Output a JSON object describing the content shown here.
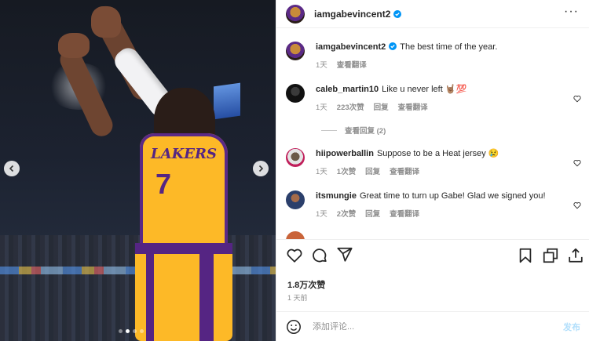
{
  "post": {
    "author": "iamgabevincent2",
    "caption": "The best time of the year.",
    "caption_time": "1天",
    "translate_label": "查看翻译",
    "more_icon": "more-horizontal-icon"
  },
  "photo": {
    "jersey_text": "LAKERS",
    "jersey_number": "7",
    "slide_count": 4,
    "active_slide": 2
  },
  "comments": [
    {
      "user": "caleb_martin10",
      "text": "Like u never left",
      "emoji": "🤘🏽💯",
      "time": "1天",
      "likes": "223次赞",
      "reply": "回复",
      "translate": "查看翻译"
    },
    {
      "user": "hiipowerballin",
      "text": "Suppose to be a Heat jersey",
      "emoji": "😢",
      "time": "1天",
      "likes": "1次赞",
      "reply": "回复",
      "translate": "查看翻译"
    },
    {
      "user": "itsmungie",
      "text": "Great time to turn up Gabe! Glad we signed you!",
      "time": "1天",
      "likes": "2次赞",
      "reply": "回复",
      "translate": "查看翻译"
    }
  ],
  "replies_label": "查看回复 (2)",
  "actions": {
    "likes_count": "1.8万次赞",
    "post_date": "1 天前"
  },
  "composer": {
    "placeholder": "添加评论...",
    "post_label": "发布"
  },
  "colors": {
    "verified_blue": "#0095f6",
    "post_button": "#b2dffc",
    "lakers_gold": "#fdb927",
    "lakers_purple": "#552583"
  }
}
